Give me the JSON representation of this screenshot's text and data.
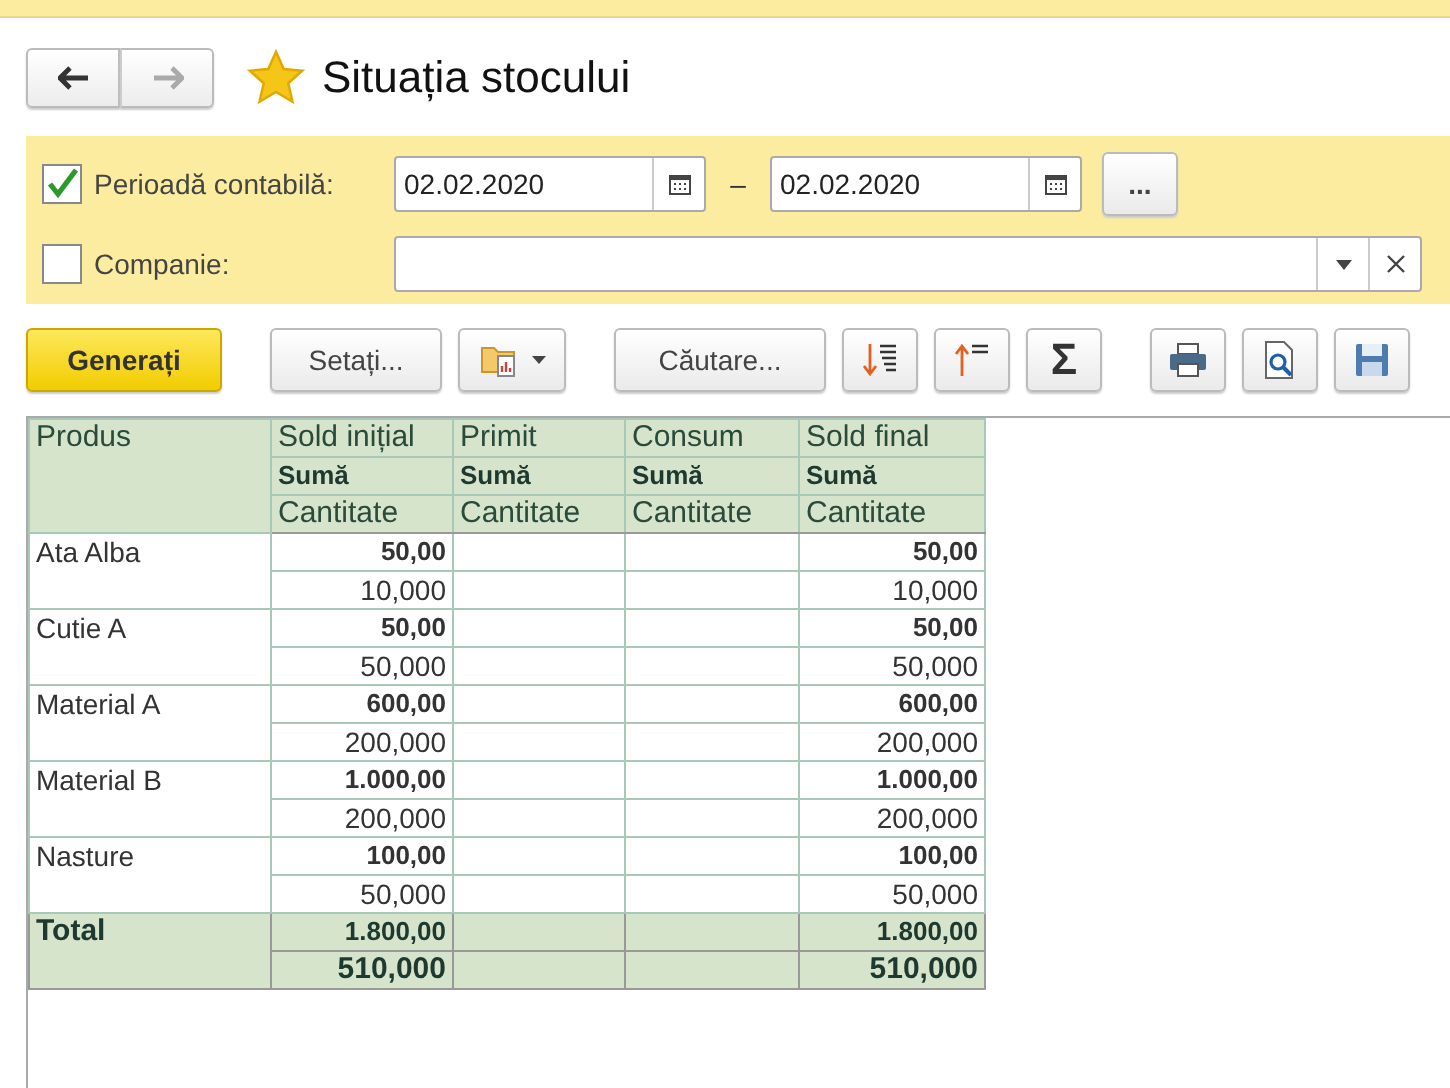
{
  "header": {
    "back_disabled": false,
    "forward_disabled": true,
    "favorite": true,
    "title": "Situația stocului"
  },
  "filters": [
    {
      "kind": "period",
      "label": "Perioadă contabilă:",
      "checked": true,
      "from": "02.02.2020",
      "separator": "–",
      "to": "02.02.2020",
      "more": "..."
    },
    {
      "kind": "select",
      "label": "Companie:",
      "checked": false
    }
  ],
  "toolbar": {
    "generate": "Generați",
    "settings": "Setați...",
    "search": "Căutare...",
    "sum": "Σ"
  },
  "table": {
    "first_column": "Produs",
    "columns": [
      {
        "label": "Sold inițial",
        "sub_1": "Sumă",
        "sub_2": "Cantitate"
      },
      {
        "label": "Primit",
        "sub_1": "Sumă",
        "sub_2": "Cantitate"
      },
      {
        "label": "Consum",
        "sub_1": "Sumă",
        "sub_2": "Cantitate"
      },
      {
        "label": "Sold final",
        "sub_1": "Sumă",
        "sub_2": "Cantitate"
      }
    ],
    "rows": [
      {
        "name": "Ata Alba",
        "sold_initial": {
          "sum": "50,00",
          "quantity": "10,000"
        },
        "sold_final": {
          "sum": "50,00",
          "quantity": "10,000"
        }
      },
      {
        "name": "Cutie A",
        "sold_initial": {
          "sum": "50,00",
          "quantity": "50,000"
        },
        "sold_final": {
          "sum": "50,00",
          "quantity": "50,000"
        }
      },
      {
        "name": "Material A",
        "sold_initial": {
          "sum": "600,00",
          "quantity": "200,000"
        },
        "sold_final": {
          "sum": "600,00",
          "quantity": "200,000"
        }
      },
      {
        "name": "Material B",
        "sold_initial": {
          "sum": "1.000,00",
          "quantity": "200,000"
        },
        "sold_final": {
          "sum": "1.000,00",
          "quantity": "200,000"
        }
      },
      {
        "name": "Nasture",
        "sold_initial": {
          "sum": "100,00",
          "quantity": "50,000"
        },
        "sold_final": {
          "sum": "100,00",
          "quantity": "50,000"
        }
      }
    ],
    "total": {
      "name": "Total",
      "sold_initial": {
        "sum": "1.800,00",
        "quantity": "510,000"
      },
      "sold_final": {
        "sum": "1.800,00",
        "quantity": "510,000"
      }
    }
  }
}
